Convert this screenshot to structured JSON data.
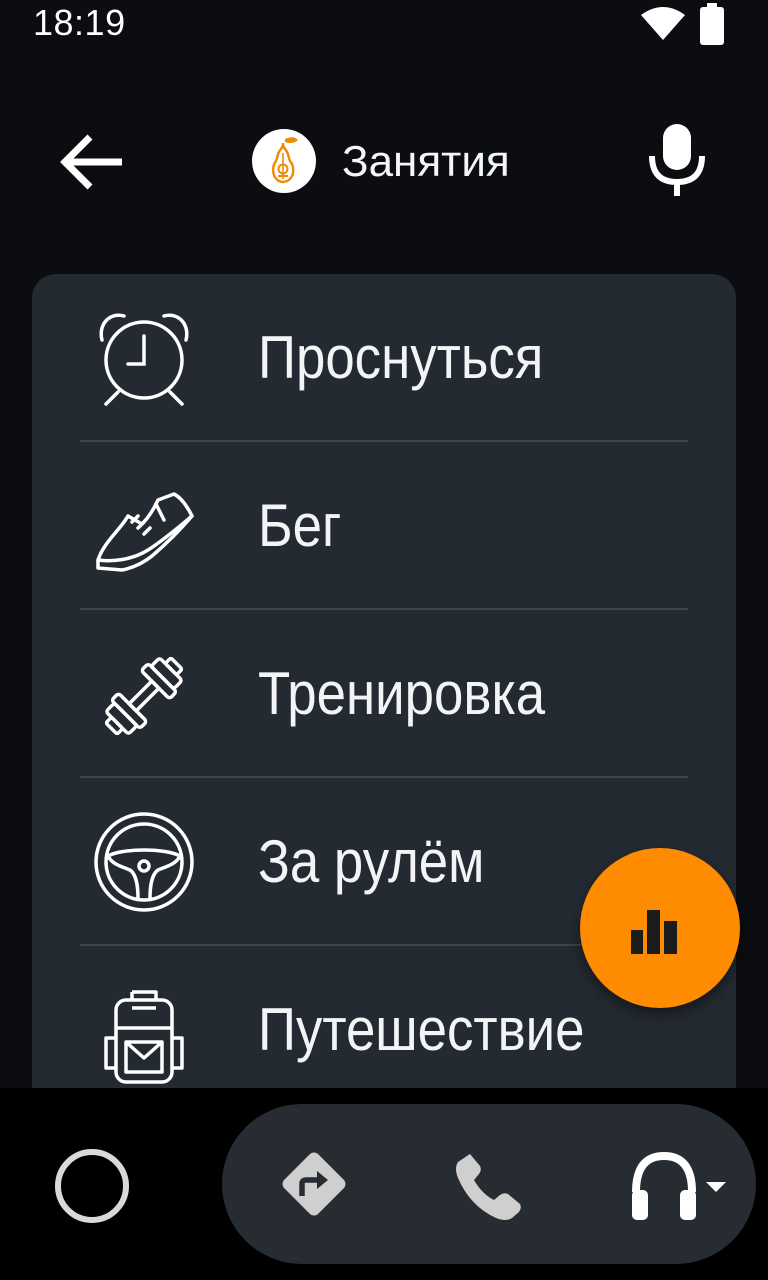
{
  "status_bar": {
    "time": "18:19",
    "wifi_icon": "wifi-icon",
    "battery_icon": "battery-icon"
  },
  "header": {
    "back_icon": "arrow-back-icon",
    "app_logo_icon": "pear-guitar-logo-icon",
    "title": "Занятия",
    "mic_icon": "microphone-icon"
  },
  "activities": [
    {
      "label": "Проснуться",
      "icon": "alarm-clock-icon"
    },
    {
      "label": "Бег",
      "icon": "running-shoe-icon"
    },
    {
      "label": "Тренировка",
      "icon": "dumbbell-icon"
    },
    {
      "label": "За рулём",
      "icon": "steering-wheel-icon"
    },
    {
      "label": "Путешествие",
      "icon": "backpack-icon"
    }
  ],
  "fab": {
    "icon": "equalizer-bars-icon"
  },
  "bottom_nav": {
    "home_icon": "home-circle-icon",
    "items": [
      {
        "icon": "navigation-directions-icon"
      },
      {
        "icon": "phone-icon"
      },
      {
        "icon": "headphones-icon"
      }
    ]
  },
  "colors": {
    "background": "#0b0d10",
    "card": "#242a31",
    "divider": "#3d444c",
    "accent": "#ff8c00",
    "nav_pill": "#272c32",
    "text": "#f2f4f5"
  }
}
